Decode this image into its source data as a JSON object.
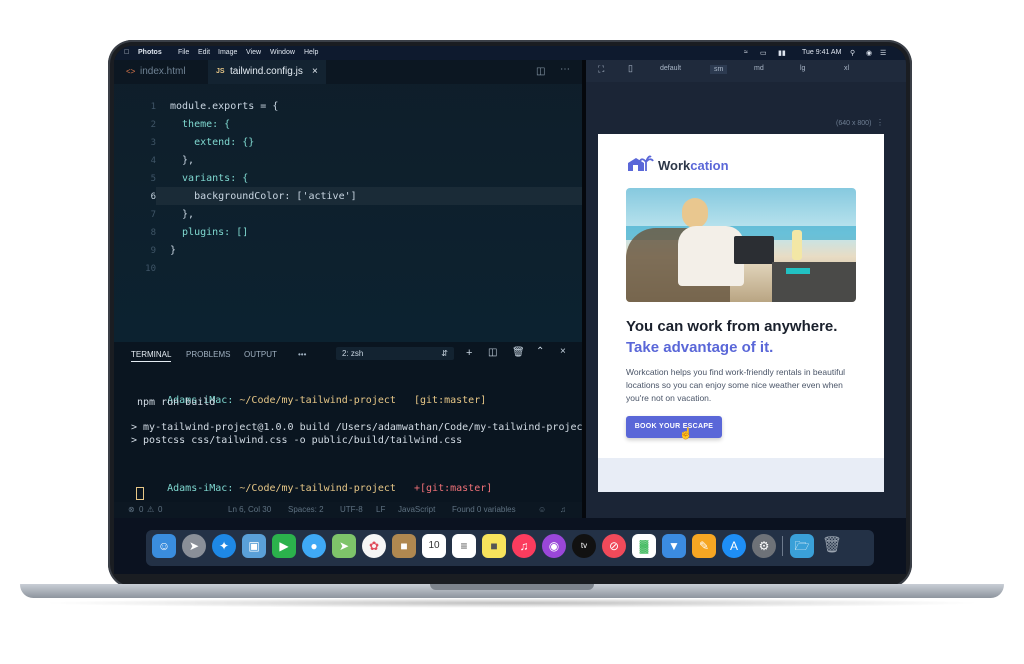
{
  "menubar": {
    "app": "Photos",
    "items": [
      "File",
      "Edit",
      "Image",
      "View",
      "Window",
      "Help"
    ],
    "clock": "Tue 9:41 AM"
  },
  "editor": {
    "tabs": [
      {
        "label": "index.html",
        "icon": "html-icon"
      },
      {
        "label": "tailwind.config.js",
        "icon": "js-icon",
        "active": true
      }
    ],
    "line_numbers": [
      "1",
      "2",
      "3",
      "4",
      "5",
      "6",
      "7",
      "8",
      "9",
      "10"
    ],
    "code_lines": [
      "module.exports = {",
      "  theme: {",
      "    extend: {}",
      "  },",
      "  variants: {",
      "    backgroundColor: ['active']",
      "  },",
      "  plugins: []",
      "}",
      ""
    ]
  },
  "terminal": {
    "tabs": [
      "TERMINAL",
      "PROBLEMS",
      "OUTPUT",
      "•••"
    ],
    "shell_select": "2: zsh",
    "lines": [
      {
        "prompt": "Adams-iMac:",
        "path": " ~/Code/my-tailwind-project",
        "branch": "   [git:master]"
      },
      {
        "text": " npm run build"
      },
      {
        "text": ""
      },
      {
        "text": "> my-tailwind-project@1.0.0 build /Users/adamwathan/Code/my-tailwind-project"
      },
      {
        "text": "> postcss css/tailwind.css -o public/build/tailwind.css"
      },
      {
        "text": ""
      },
      {
        "prompt": "Adams-iMac:",
        "path": " ~/Code/my-tailwind-project",
        "branch": "   +[git:master]"
      }
    ]
  },
  "statusbar": {
    "errors": "0",
    "warnings": "0",
    "position": "Ln 6, Col 30",
    "spaces": "Spaces: 2",
    "encoding": "UTF-8",
    "eol": "LF",
    "language": "JavaScript",
    "variables": "Found 0 variables"
  },
  "preview": {
    "breakpoints": [
      "default",
      "sm",
      "md",
      "lg",
      "xl"
    ],
    "size_label": "(640 x 800)",
    "brand_prefix": "Work",
    "brand_suffix": "cation",
    "headline": "You can work from anywhere.",
    "subheadline": "Take advantage of it.",
    "body": "Workcation helps you find work-friendly rentals in beautiful locations so you can enjoy some nice weather even when you're not on vacation.",
    "cta": "BOOK YOUR ESCAPE",
    "accent": "#5a67d8"
  },
  "dock": {
    "icons": [
      "finder-icon",
      "launchpad-icon",
      "safari-icon",
      "preview-icon",
      "facetime-icon",
      "messages-icon",
      "maps-icon",
      "photos-icon",
      "contacts-icon",
      "calendar-icon",
      "notes-icon",
      "stickies-icon",
      "music-icon",
      "podcasts-icon",
      "tv-icon",
      "news-icon",
      "numbers-icon",
      "keynote-icon",
      "pages-icon",
      "appstore-icon",
      "settings-icon",
      "folder-icon",
      "trash-icon"
    ],
    "calendar_day": "10"
  }
}
